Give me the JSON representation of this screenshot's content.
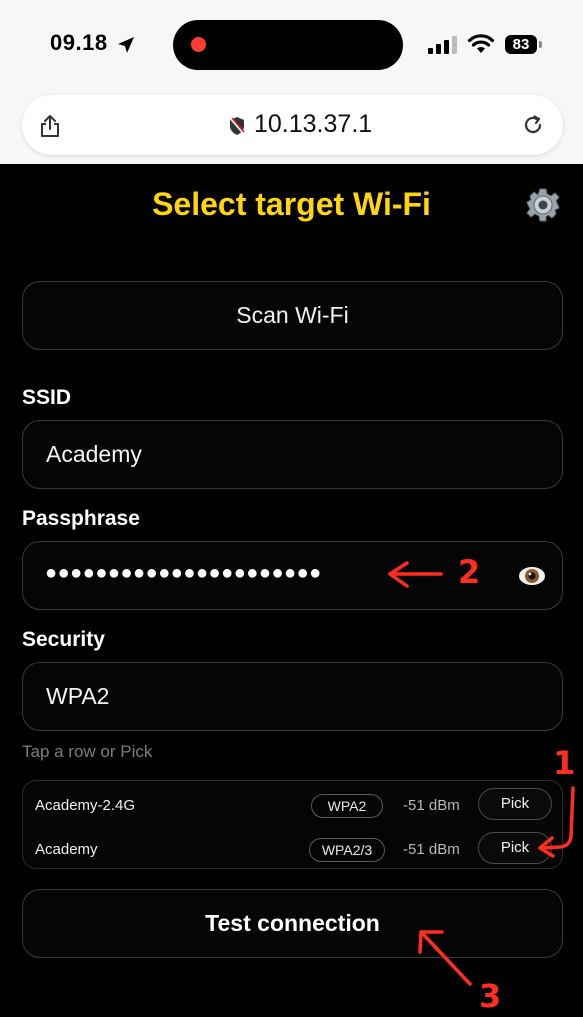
{
  "status_bar": {
    "time": "09.18",
    "battery": "83"
  },
  "browser": {
    "url": "10.13.37.1"
  },
  "page": {
    "title": "Select target Wi-Fi"
  },
  "scan_button": {
    "label": "Scan Wi-Fi"
  },
  "ssid": {
    "label": "SSID",
    "value": "Academy"
  },
  "passphrase": {
    "label": "Passphrase",
    "masked_value": "●●●●●●●●●●●●●●●●●●●●●●"
  },
  "security": {
    "label": "Security",
    "value": "WPA2"
  },
  "results_hint": "Tap a row or Pick",
  "networks": [
    {
      "ssid": "Academy-2.4G",
      "security": "WPA2",
      "signal": "-51 dBm",
      "action": "Pick"
    },
    {
      "ssid": "Academy",
      "security": "WPA2/3",
      "signal": "-51 dBm",
      "action": "Pick"
    }
  ],
  "test_button": {
    "label": "Test connection"
  },
  "annotations": {
    "one": "1",
    "two": "2",
    "three": "3"
  },
  "colors": {
    "accent_title": "#ffd60a",
    "annotation": "#ff2d20",
    "background": "#000000"
  }
}
